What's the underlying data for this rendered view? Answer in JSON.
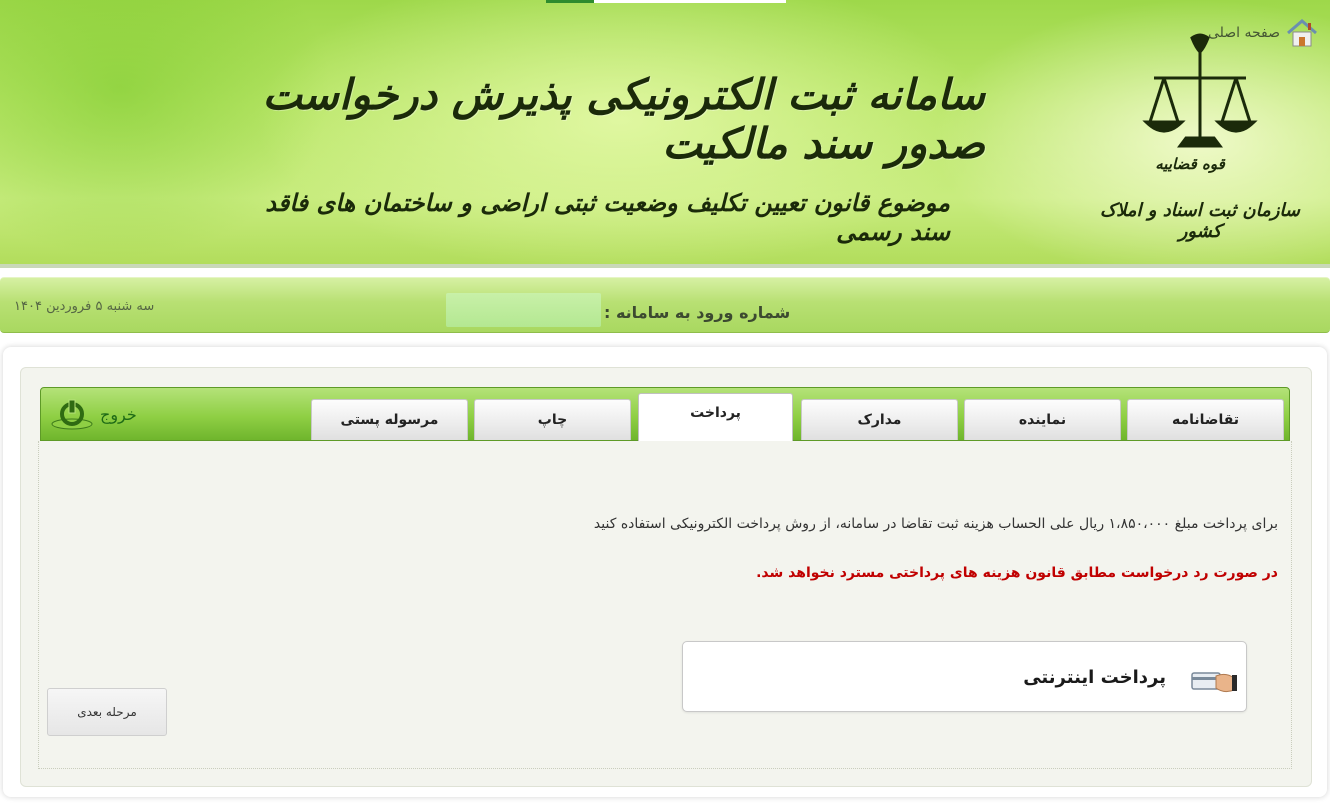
{
  "header": {
    "title": "سامانه ثبت الکترونیکی پذیرش درخواست صدور سند مالکیت",
    "subtitle": "موضوع قانون تعیین تکلیف وضعیت ثبتی اراضی و ساختمان های فاقد سند رسمی",
    "org_line1": "قوه قضاییه",
    "org_line2": "سازمان ثبت اسناد و املاک کشور",
    "emblem_icon": "scales-of-justice-icon"
  },
  "infobar": {
    "home_label": "صفحه اصلی",
    "home_icon": "home-icon",
    "login_label": "شماره ورود به سامانه :",
    "date": "سه شنبه ۵ فروردین ۱۴۰۴"
  },
  "tabs": [
    {
      "label": "تقاضانامه",
      "active": false
    },
    {
      "label": "نماینده",
      "active": false
    },
    {
      "label": "مدارک",
      "active": false
    },
    {
      "label": "پرداخت",
      "active": true
    },
    {
      "label": "چاپ",
      "active": false
    },
    {
      "label": "مرسوله پستی",
      "active": false
    }
  ],
  "logout": {
    "label": "خروج",
    "icon": "power-icon"
  },
  "content": {
    "payment_message": "برای پرداخت مبلغ ۱،۸۵۰،۰۰۰ ریال علی الحساب هزینه ثبت تقاضا در سامانه، از روش پرداخت الکترونیکی استفاده کنید",
    "warning_message": "در صورت رد درخواست مطابق قانون هزینه های پرداختی مسترد نخواهد شد.",
    "online_payment_label": "پرداخت اینترنتی",
    "next_button": "مرحله بعدی"
  },
  "colors": {
    "accent_green": "#8fcf44",
    "warning_red": "#c00000"
  }
}
